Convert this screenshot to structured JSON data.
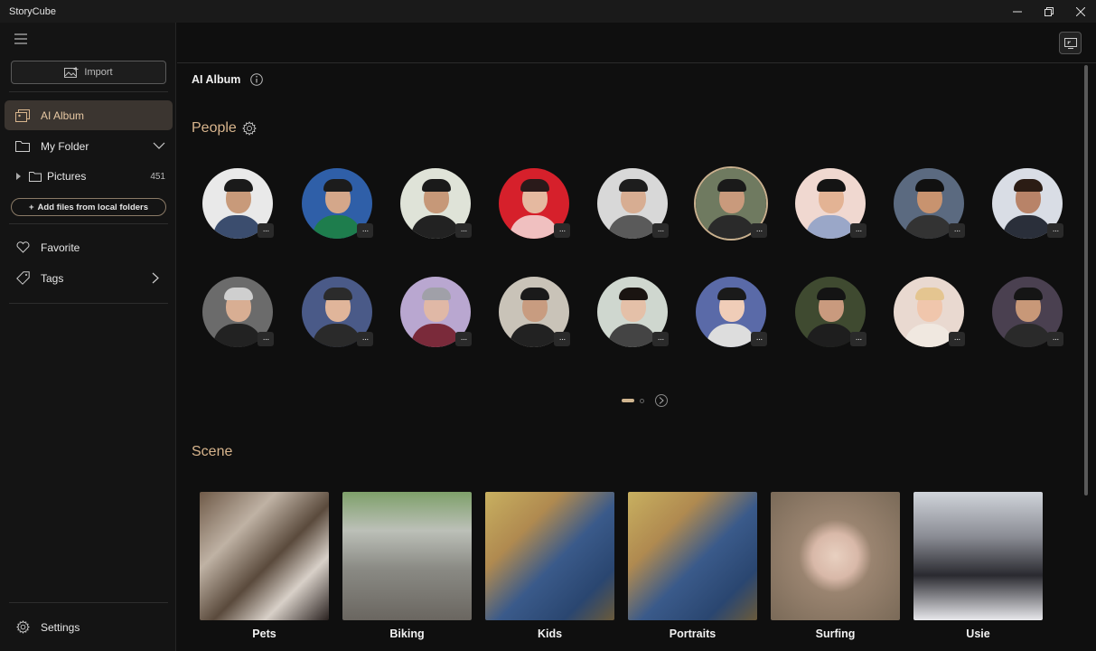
{
  "app": {
    "title": "StoryCube"
  },
  "sidebar": {
    "import_label": "Import",
    "items": [
      {
        "label": "AI Album"
      },
      {
        "label": "My Folder"
      },
      {
        "label": "Favorite"
      },
      {
        "label": "Tags"
      },
      {
        "label": "Settings"
      }
    ],
    "pictures": {
      "label": "Pictures",
      "count": "451"
    },
    "add_files_label": "Add files from local folders"
  },
  "main": {
    "title": "AI Album",
    "people_title": "People",
    "scene_title": "Scene",
    "more_glyph": "···",
    "scenes": [
      {
        "label": "Pets"
      },
      {
        "label": "Biking"
      },
      {
        "label": "Kids"
      },
      {
        "label": "Portraits"
      },
      {
        "label": "Surfing"
      },
      {
        "label": "Usie"
      }
    ],
    "people_page": {
      "current": 1,
      "total": 2
    }
  },
  "colors": {
    "accent": "#d8b58d",
    "sidebar_bg": "#141414",
    "main_bg": "#0f0f0f",
    "active_item_bg": "#3b3530"
  },
  "icons": {
    "menu": "hamburger-icon",
    "import": "image-import-icon",
    "album": "album-icon",
    "folder": "folder-icon",
    "heart": "heart-icon",
    "tag": "tag-icon",
    "settings": "gear-icon",
    "info": "info-icon",
    "cast": "cast-icon"
  }
}
